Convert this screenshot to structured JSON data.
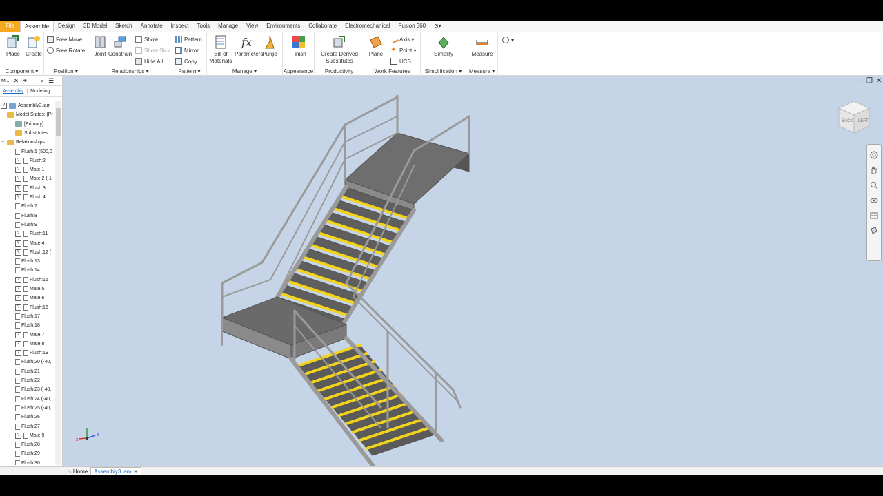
{
  "menu": {
    "tabs": [
      "File",
      "Assemble",
      "Design",
      "3D Model",
      "Sketch",
      "Annotate",
      "Inspect",
      "Tools",
      "Manage",
      "View",
      "Environments",
      "Collaborate",
      "Electromechanical",
      "Fusion 360"
    ],
    "active": "Assemble"
  },
  "ribbon": {
    "component": {
      "label": "Component",
      "place": "Place",
      "create": "Create"
    },
    "position": {
      "label": "Position",
      "free_move": "Free Move",
      "free_rotate": "Free Rotate"
    },
    "relationships": {
      "label": "Relationships",
      "joint": "Joint",
      "constrain": "Constrain",
      "show": "Show",
      "show_sick": "Show Sick",
      "hide_all": "Hide All"
    },
    "pattern": {
      "label": "Pattern",
      "pattern": "Pattern",
      "mirror": "Mirror",
      "copy": "Copy"
    },
    "manage": {
      "label": "Manage",
      "bom": "Bill of Materials",
      "parameters": "Parameters",
      "purge": "Purge"
    },
    "appearance": {
      "label": "Appearance",
      "finish": "Finish"
    },
    "productivity": {
      "label": "Productivity",
      "create_derived": "Create Derived Substitutes"
    },
    "work_features": {
      "label": "Work Features",
      "plane": "Plane",
      "axis": "Axis",
      "point": "Point",
      "ucs": "UCS"
    },
    "simplification": {
      "label": "Simplification",
      "simplify": "Simplify"
    },
    "measure": {
      "label": "Measure",
      "measure": "Measure"
    }
  },
  "browser": {
    "head_title": "M...",
    "tabs": [
      "Assembly",
      "Modeling"
    ],
    "active_tab": "Assembly",
    "root": "Assembly3.iam",
    "model_states": "Model States: [Pr",
    "primary": "[Primary]",
    "substitutes": "Substitutes",
    "relationships": "Relationships",
    "items": [
      {
        "label": "Flush:1 (500,0",
        "sick": false
      },
      {
        "label": "Flush:2",
        "sick": true
      },
      {
        "label": "Mate:1",
        "sick": true
      },
      {
        "label": "Mate:2 (-1",
        "sick": true
      },
      {
        "label": "Flush:3",
        "sick": true
      },
      {
        "label": "Flush:4",
        "sick": true
      },
      {
        "label": "Flush:7",
        "sick": false
      },
      {
        "label": "Flush:8",
        "sick": false
      },
      {
        "label": "Flush:9",
        "sick": false
      },
      {
        "label": "Flush:11",
        "sick": true
      },
      {
        "label": "Mate:4",
        "sick": true
      },
      {
        "label": "Flush:12 (",
        "sick": true
      },
      {
        "label": "Flush:13",
        "sick": false
      },
      {
        "label": "Flush:14",
        "sick": false
      },
      {
        "label": "Flush:15",
        "sick": true
      },
      {
        "label": "Mate:5",
        "sick": true
      },
      {
        "label": "Mate:6",
        "sick": true
      },
      {
        "label": "Flush:16",
        "sick": true
      },
      {
        "label": "Flush:17",
        "sick": false
      },
      {
        "label": "Flush:18",
        "sick": false
      },
      {
        "label": "Mate:7",
        "sick": true
      },
      {
        "label": "Mate:8",
        "sick": true
      },
      {
        "label": "Flush:19",
        "sick": true
      },
      {
        "label": "Flush:20 (-40,",
        "sick": false
      },
      {
        "label": "Flush:21",
        "sick": false
      },
      {
        "label": "Flush:22",
        "sick": false
      },
      {
        "label": "Flush:23 (-40,",
        "sick": false
      },
      {
        "label": "Flush:24 (-40,",
        "sick": false
      },
      {
        "label": "Flush:25 (-40,",
        "sick": false
      },
      {
        "label": "Flush:26",
        "sick": false
      },
      {
        "label": "Flush:27",
        "sick": false
      },
      {
        "label": "Mate:9",
        "sick": true
      },
      {
        "label": "Flush:28",
        "sick": false
      },
      {
        "label": "Flush:29",
        "sick": false
      },
      {
        "label": "Flush:30",
        "sick": false
      }
    ]
  },
  "viewcube": {
    "face1": "BACK",
    "face2": "LEFT"
  },
  "status": {
    "home": "Home",
    "doc": "Assembly3.iam"
  },
  "colors": {
    "file_tab": "#f7a91e",
    "viewport_bg": "#c5d4e6",
    "tread_nosing": "#f2d31a",
    "steel": "#9a9a9a"
  }
}
